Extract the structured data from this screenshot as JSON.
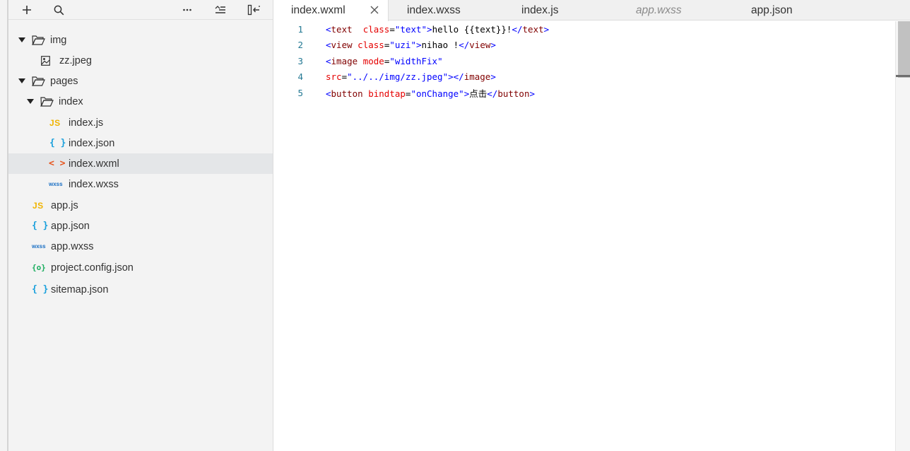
{
  "toolbar": {
    "icons": [
      "plus-icon",
      "search-icon",
      "more-icon",
      "collapse-all-icon",
      "hide-sidebar-icon"
    ]
  },
  "tree": {
    "img": "img",
    "zz_jpeg": "zz.jpeg",
    "pages": "pages",
    "index": "index",
    "index_js": "index.js",
    "index_json": "index.json",
    "index_wxml": "index.wxml",
    "index_wxss": "index.wxss",
    "app_js": "app.js",
    "app_json": "app.json",
    "app_wxss": "app.wxss",
    "project_config": "project.config.json",
    "sitemap": "sitemap.json"
  },
  "icons": {
    "js": "JS",
    "json": "{ }",
    "wxml": "< >",
    "wxss": "wxss",
    "project": "{o}"
  },
  "tabs": [
    {
      "label": "index.wxml",
      "active": true
    },
    {
      "label": "index.wxss"
    },
    {
      "label": "index.js"
    },
    {
      "label": "app.wxss",
      "preview": true
    },
    {
      "label": "app.json"
    }
  ],
  "editor": {
    "lines": [
      {
        "n": "1",
        "tokens": [
          [
            "brk",
            "<"
          ],
          [
            "tag",
            "text"
          ],
          [
            "txt",
            "  "
          ],
          [
            "attr",
            "class"
          ],
          [
            "eq",
            "="
          ],
          [
            "str",
            "\"text\""
          ],
          [
            "brk",
            ">"
          ],
          [
            "txt",
            "hello {{text}}!"
          ],
          [
            "brk",
            "</"
          ],
          [
            "tag",
            "text"
          ],
          [
            "brk",
            ">"
          ]
        ]
      },
      {
        "n": "2",
        "tokens": [
          [
            "brk",
            "<"
          ],
          [
            "tag",
            "view"
          ],
          [
            "txt",
            " "
          ],
          [
            "attr",
            "class"
          ],
          [
            "eq",
            "="
          ],
          [
            "str",
            "\"uzi\""
          ],
          [
            "brk",
            ">"
          ],
          [
            "txt",
            "nihao !"
          ],
          [
            "brk",
            "</"
          ],
          [
            "tag",
            "view"
          ],
          [
            "brk",
            ">"
          ]
        ]
      },
      {
        "n": "3",
        "tokens": [
          [
            "brk",
            "<"
          ],
          [
            "tag",
            "image"
          ],
          [
            "txt",
            " "
          ],
          [
            "attr",
            "mode"
          ],
          [
            "eq",
            "="
          ],
          [
            "str",
            "\"widthFix\""
          ]
        ]
      },
      {
        "n": "4",
        "tokens": [
          [
            "attr",
            "src"
          ],
          [
            "eq",
            "="
          ],
          [
            "str",
            "\"../../img/zz.jpeg\""
          ],
          [
            "brk",
            "></"
          ],
          [
            "tag",
            "image"
          ],
          [
            "brk",
            ">"
          ]
        ]
      },
      {
        "n": "5",
        "tokens": [
          [
            "brk",
            "<"
          ],
          [
            "tag",
            "button"
          ],
          [
            "txt",
            " "
          ],
          [
            "attr",
            "bindtap"
          ],
          [
            "eq",
            "="
          ],
          [
            "str",
            "\"onChange\""
          ],
          [
            "brk",
            ">"
          ],
          [
            "txt",
            "点击"
          ],
          [
            "brk",
            "</"
          ],
          [
            "tag",
            "button"
          ],
          [
            "brk",
            ">"
          ]
        ]
      }
    ]
  },
  "colors": {
    "tag": "#800000",
    "bracket": "#0000ff",
    "attr": "#e50000",
    "string": "#0000ff",
    "line_number": "#237893",
    "js_icon": "#f0b400",
    "json_icon": "#1aa0dc",
    "wxml_icon": "#e6551e",
    "wxss_icon": "#1a6fc4",
    "project_icon": "#1aad5e"
  }
}
